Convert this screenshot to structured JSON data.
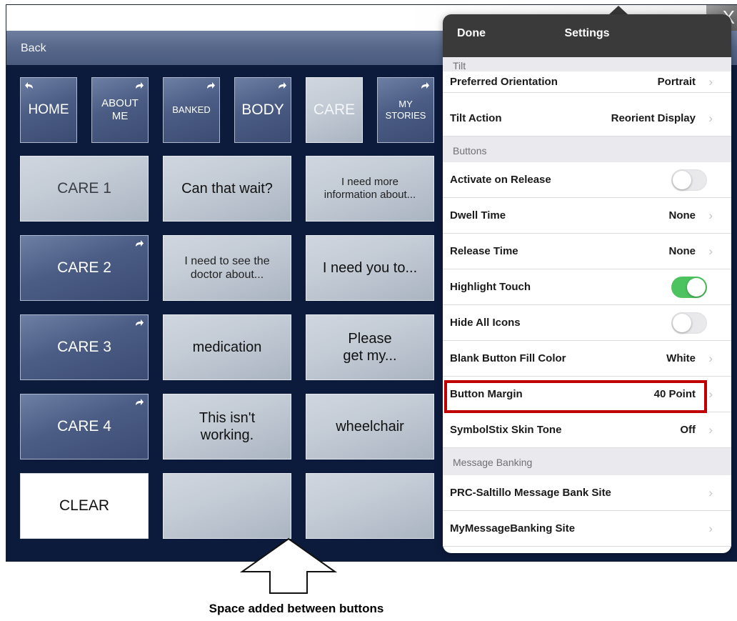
{
  "app": {
    "back_label": "Back",
    "close_glyph": "X"
  },
  "nav_row": [
    {
      "label_line1": "HOME",
      "label_line2": "",
      "arrow": "back",
      "style": "dark"
    },
    {
      "label_line1": "ABOUT",
      "label_line2": "ME",
      "arrow": "forward",
      "style": "dark"
    },
    {
      "label_line1": "BANKED",
      "label_line2": "",
      "arrow": "forward",
      "style": "dark"
    },
    {
      "label_line1": "BODY",
      "label_line2": "",
      "arrow": "forward",
      "style": "dark"
    },
    {
      "label_line1": "CARE",
      "label_line2": "",
      "arrow": "none",
      "style": "light"
    },
    {
      "label_line1": "MY",
      "label_line2": "STORIES",
      "arrow": "forward",
      "style": "dark"
    }
  ],
  "grid": [
    [
      {
        "label_line1": "CARE 1",
        "label_line2": "",
        "style": "light",
        "arrow": "none"
      },
      {
        "label_line1": "Can that wait?",
        "label_line2": "",
        "style": "light",
        "arrow": "none"
      },
      {
        "label_line1": "I need more",
        "label_line2": "information about...",
        "style": "light",
        "arrow": "none"
      }
    ],
    [
      {
        "label_line1": "CARE 2",
        "label_line2": "",
        "style": "dark",
        "arrow": "forward"
      },
      {
        "label_line1": "I need to see the",
        "label_line2": "doctor about...",
        "style": "light",
        "arrow": "none"
      },
      {
        "label_line1": "I need you to...",
        "label_line2": "",
        "style": "light",
        "arrow": "none"
      }
    ],
    [
      {
        "label_line1": "CARE 3",
        "label_line2": "",
        "style": "dark",
        "arrow": "forward"
      },
      {
        "label_line1": "medication",
        "label_line2": "",
        "style": "light",
        "arrow": "none"
      },
      {
        "label_line1": "Please",
        "label_line2": "get my...",
        "style": "light",
        "arrow": "none"
      }
    ],
    [
      {
        "label_line1": "CARE 4",
        "label_line2": "",
        "style": "dark",
        "arrow": "forward"
      },
      {
        "label_line1": "This isn't",
        "label_line2": "working.",
        "style": "light",
        "arrow": "none"
      },
      {
        "label_line1": "wheelchair",
        "label_line2": "",
        "style": "light",
        "arrow": "none"
      }
    ],
    [
      {
        "label_line1": "CLEAR",
        "label_line2": "",
        "style": "white",
        "arrow": "none"
      },
      {
        "label_line1": "",
        "label_line2": "",
        "style": "light",
        "arrow": "none"
      },
      {
        "label_line1": "",
        "label_line2": "",
        "style": "light",
        "arrow": "none"
      }
    ]
  ],
  "settings": {
    "done_label": "Done",
    "title": "Settings",
    "sections": {
      "tilt": "Tilt",
      "buttons": "Buttons",
      "message_banking": "Message Banking"
    },
    "rows": {
      "preferred_orientation": {
        "label": "Preferred Orientation",
        "value": "Portrait"
      },
      "tilt_action": {
        "label": "Tilt Action",
        "value": "Reorient Display"
      },
      "activate_on_release": {
        "label": "Activate on Release",
        "toggle": false
      },
      "dwell_time": {
        "label": "Dwell Time",
        "value": "None"
      },
      "release_time": {
        "label": "Release Time",
        "value": "None"
      },
      "highlight_touch": {
        "label": "Highlight Touch",
        "toggle": true
      },
      "hide_all_icons": {
        "label": "Hide All Icons",
        "toggle": false
      },
      "blank_button_fill_color": {
        "label": "Blank Button Fill Color",
        "value": "White"
      },
      "button_margin": {
        "label": "Button Margin",
        "value": "40 Point"
      },
      "symbolstix_skin_tone": {
        "label": "SymbolStix Skin Tone",
        "value": "Off"
      },
      "prc_saltillo_site": {
        "label": "PRC-Saltillo Message Bank Site"
      },
      "mymessagebanking_site": {
        "label": "MyMessageBanking Site"
      }
    },
    "chevron_glyph": "›"
  },
  "colors": {
    "highlight_border": "#c00000",
    "toggle_on": "#4cc35f",
    "screen_background": "#0c1a3c"
  },
  "annotation": {
    "caption": "Space added between buttons"
  }
}
